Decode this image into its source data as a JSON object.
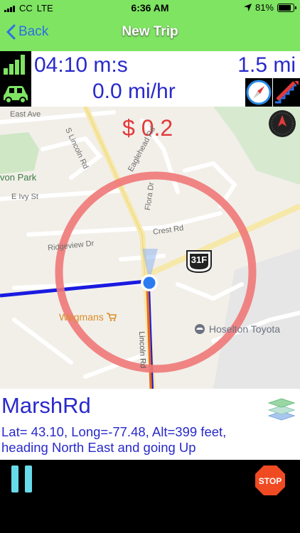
{
  "status_bar": {
    "carrier": "CC",
    "network": "LTE",
    "time": "6:36 AM",
    "battery": "81%",
    "icons": [
      "signal-bars-icon",
      "location-arrow-icon",
      "battery-icon"
    ]
  },
  "nav": {
    "back_label": "Back",
    "title": "New Trip"
  },
  "trip": {
    "elapsed": "04:10 m:s",
    "distance": "1.5 mi",
    "speed": "0.0 mi/hr",
    "fare": "$ 0.2"
  },
  "map_labels": {
    "east_ave": "East Ave",
    "s_lincoln_rd": "S Lincoln Rd",
    "eaglehead_rd": "Eaglehead Rd",
    "flora_dr": "Flora Dr",
    "park": "von Park",
    "e_ivy_st": "E Ivy St",
    "ridgeview_dr": "Ridgeview Dr",
    "crest_rd": "Crest Rd",
    "route_shield": "31F",
    "wegmans": "Wegmans",
    "hoselton": "Hoselton Toyota",
    "lincoln_lower": "Lincoln Rd"
  },
  "location": {
    "street": "MarshRd",
    "coords_line": "Lat= 43.10, Long=-77.48, Alt=399 feet,",
    "heading_line": "heading North East and going Up"
  },
  "colors": {
    "accent_green": "#7ee462",
    "value_blue": "#2929cc",
    "fare_red": "#e23a3a",
    "pause_cyan": "#67dbea",
    "stop_red": "#f04a22"
  },
  "icons": [
    "signal-strength-icon",
    "car-icon",
    "compass-icon",
    "stairs-icon",
    "map-compass-icon",
    "layers-icon",
    "pause-icon",
    "stop-icon",
    "shopping-cart-icon",
    "car-dealer-icon"
  ]
}
